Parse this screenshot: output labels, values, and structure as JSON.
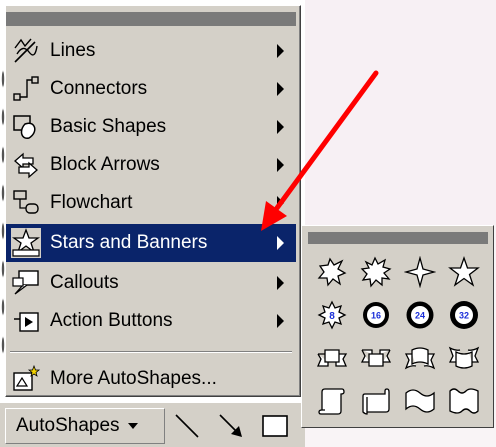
{
  "menu": {
    "items": [
      {
        "label": "Lines",
        "icon": "lines-icon",
        "has_submenu": true,
        "active": false
      },
      {
        "label": "Connectors",
        "icon": "connectors-icon",
        "has_submenu": true,
        "active": false
      },
      {
        "label": "Basic Shapes",
        "icon": "basic-shapes-icon",
        "has_submenu": true,
        "active": false
      },
      {
        "label": "Block Arrows",
        "icon": "block-arrows-icon",
        "has_submenu": true,
        "active": false
      },
      {
        "label": "Flowchart",
        "icon": "flowchart-icon",
        "has_submenu": true,
        "active": false
      },
      {
        "label": "Stars and Banners",
        "icon": "stars-banners-icon",
        "has_submenu": true,
        "active": true
      },
      {
        "label": "Callouts",
        "icon": "callouts-icon",
        "has_submenu": true,
        "active": false
      },
      {
        "label": "Action Buttons",
        "icon": "action-buttons-icon",
        "has_submenu": true,
        "active": false
      },
      {
        "label": "More AutoShapes...",
        "icon": "more-autoshapes-icon",
        "has_submenu": false,
        "active": false
      }
    ]
  },
  "toolbar": {
    "autoshapes_label": "AutoShapes",
    "tools": [
      "line-tool-icon",
      "arrow-tool-icon",
      "rectangle-tool-icon"
    ]
  },
  "submenu": {
    "title": "Stars and Banners",
    "shapes": [
      {
        "name": "explosion-1-icon"
      },
      {
        "name": "explosion-2-icon"
      },
      {
        "name": "4-point-star-icon"
      },
      {
        "name": "5-point-star-icon"
      },
      {
        "name": "8-point-star-icon",
        "label": "8"
      },
      {
        "name": "16-point-star-icon",
        "label": "16"
      },
      {
        "name": "24-point-star-icon",
        "label": "24"
      },
      {
        "name": "32-point-star-icon",
        "label": "32"
      },
      {
        "name": "up-ribbon-icon"
      },
      {
        "name": "down-ribbon-icon"
      },
      {
        "name": "curved-up-ribbon-icon"
      },
      {
        "name": "curved-down-ribbon-icon"
      },
      {
        "name": "vertical-scroll-icon"
      },
      {
        "name": "horizontal-scroll-icon"
      },
      {
        "name": "wave-icon"
      },
      {
        "name": "double-wave-icon"
      }
    ]
  },
  "colors": {
    "highlight": "#0a246a",
    "menu_face": "#d4d0c8",
    "badge_text": "#1a2ed8",
    "annotation_arrow": "#ff0000"
  }
}
